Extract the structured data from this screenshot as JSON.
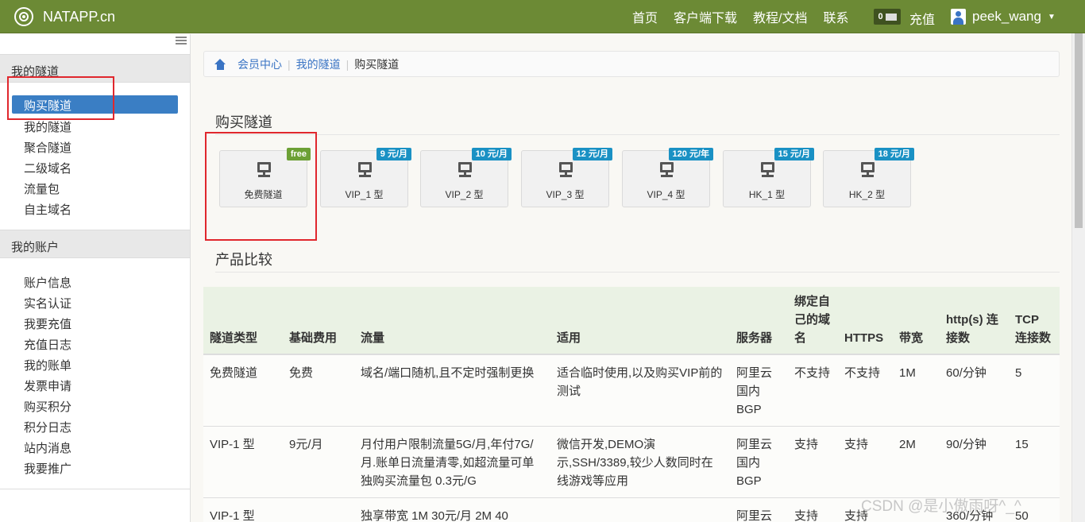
{
  "navbar": {
    "brand": "NATAPP.cn",
    "links": [
      "首页",
      "客户端下载",
      "教程/文档",
      "联系"
    ],
    "message_count": "0",
    "recharge": "充值",
    "username": "peek_wang"
  },
  "sidebar": {
    "section1": "我的隧道",
    "tunnel_items": [
      "购买隧道",
      "我的隧道",
      "聚合隧道",
      "二级域名",
      "流量包",
      "自主域名"
    ],
    "section2": "我的账户",
    "account_items": [
      "账户信息",
      "实名认证",
      "我要充值",
      "充值日志",
      "我的账单",
      "发票申请",
      "购买积分",
      "积分日志",
      "站内消息",
      "我要推广"
    ]
  },
  "breadcrumb": [
    "会员中心",
    "我的隧道",
    "购买隧道"
  ],
  "buy_title": "购买隧道",
  "tunnels": [
    {
      "name": "免费隧道",
      "badge": "free"
    },
    {
      "name": "VIP_1 型",
      "badge": "9 元/月"
    },
    {
      "name": "VIP_2 型",
      "badge": "10 元/月"
    },
    {
      "name": "VIP_3 型",
      "badge": "12 元/月"
    },
    {
      "name": "VIP_4 型",
      "badge": "120 元/年"
    },
    {
      "name": "HK_1 型",
      "badge": "15 元/月"
    },
    {
      "name": "HK_2 型",
      "badge": "18 元/月"
    }
  ],
  "compare_title": "产品比较",
  "table": {
    "headers": [
      "隧道类型",
      "基础费用",
      "流量",
      "适用",
      "服务器",
      "绑定自己的域名",
      "HTTPS",
      "带宽",
      "http(s) 连接数",
      "TCP 连接数"
    ],
    "rows": [
      [
        "免费隧道",
        "免费",
        "域名/端口随机,且不定时强制更换",
        "适合临时使用,以及购买VIP前的测试",
        "阿里云国内BGP",
        "不支持",
        "不支持",
        "1M",
        "60/分钟",
        "5"
      ],
      [
        "VIP-1 型",
        "9元/月",
        "月付用户限制流量5G/月,年付7G/月.账单日流量清零,如超流量可单独购买流量包 0.3元/G",
        "微信开发,DEMO演示,SSH/3389,较少人数同时在线游戏等应用",
        "阿里云国内BGP",
        "支持",
        "支持",
        "2M",
        "90/分钟",
        "15"
      ],
      [
        "VIP-1 型",
        "",
        "独享带宽 1M 30元/月 2M 40",
        "",
        "阿里云",
        "支持",
        "支持",
        "",
        "360/分钟",
        "50"
      ]
    ]
  },
  "watermark": "CSDN @是小傲雨呀^_^",
  "colors": {
    "navbar": "#6c8a35",
    "active": "#3a7ec4",
    "badge": "#1a91c4",
    "free_badge": "#6ca035",
    "highlight": "#e0272d"
  }
}
